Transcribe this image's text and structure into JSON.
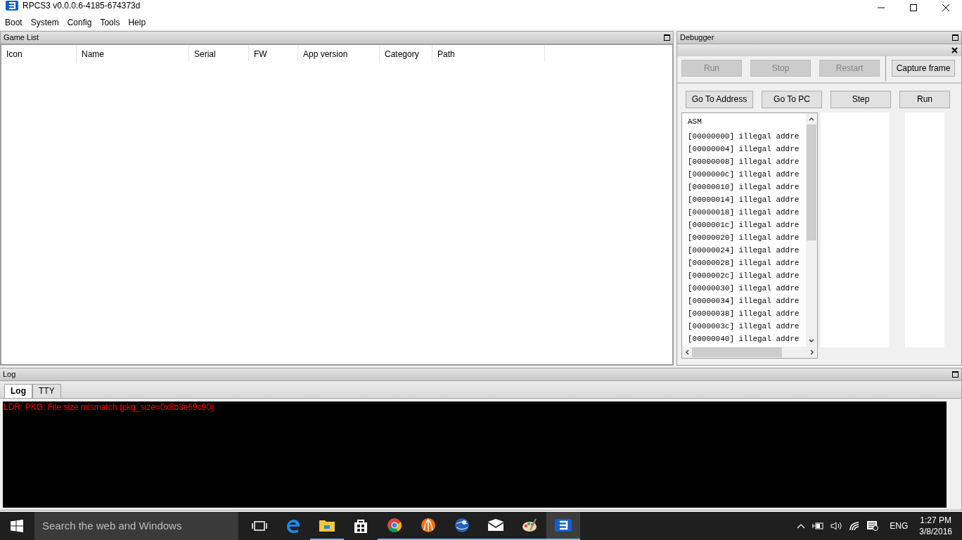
{
  "window": {
    "title": "RPCS3 v0.0.0.6-4185-674373d"
  },
  "menu": [
    "Boot",
    "System",
    "Config",
    "Tools",
    "Help"
  ],
  "game_list": {
    "title": "Game List",
    "columns": [
      "Icon",
      "Name",
      "Serial",
      "FW",
      "App version",
      "Category",
      "Path"
    ]
  },
  "debugger": {
    "title": "Debugger",
    "control_buttons": [
      {
        "label": "Run",
        "disabled": true
      },
      {
        "label": "Stop",
        "disabled": true
      },
      {
        "label": "Restart",
        "disabled": true
      },
      {
        "label": "Capture frame",
        "disabled": false
      }
    ],
    "nav_buttons": [
      {
        "label": "Go To Address",
        "disabled": false
      },
      {
        "label": "Go To PC",
        "disabled": false
      },
      {
        "label": "Step",
        "disabled": false
      },
      {
        "label": "Run",
        "disabled": false
      }
    ],
    "asm_header": "ASM",
    "asm_lines": [
      "[00000000] illegal addre",
      "[00000004] illegal addre",
      "[00000008] illegal addre",
      "[0000000c] illegal addre",
      "[00000010] illegal addre",
      "[00000014] illegal addre",
      "[00000018] illegal addre",
      "[0000001c] illegal addre",
      "[00000020] illegal addre",
      "[00000024] illegal addre",
      "[00000028] illegal addre",
      "[0000002c] illegal addre",
      "[00000030] illegal addre",
      "[00000034] illegal addre",
      "[00000038] illegal addre",
      "[0000003c] illegal addre",
      "[00000040] illegal addre"
    ]
  },
  "log": {
    "title": "Log",
    "tabs": [
      {
        "label": "Log",
        "selected": true
      },
      {
        "label": "TTY",
        "selected": false
      }
    ],
    "lines": [
      "LDR: PKG: File size mismatch (pkg_size=0x8b3e69c90)"
    ]
  },
  "taskbar": {
    "search_placeholder": "Search the web and Windows",
    "apps": [
      {
        "kind": "taskview",
        "running": false,
        "selected": false
      },
      {
        "kind": "edge",
        "running": false,
        "selected": false
      },
      {
        "kind": "folder",
        "running": true,
        "selected": false
      },
      {
        "kind": "store",
        "running": false,
        "selected": false
      },
      {
        "kind": "chrome",
        "running": true,
        "selected": false
      },
      {
        "kind": "cone",
        "running": true,
        "selected": false
      },
      {
        "kind": "globe",
        "running": true,
        "selected": false
      },
      {
        "kind": "mail",
        "running": true,
        "selected": false
      },
      {
        "kind": "paint",
        "running": true,
        "selected": false
      },
      {
        "kind": "rpcs3",
        "running": true,
        "selected": true
      }
    ],
    "language": "ENG",
    "time": "1:27 PM",
    "date": "3/8/2016"
  }
}
